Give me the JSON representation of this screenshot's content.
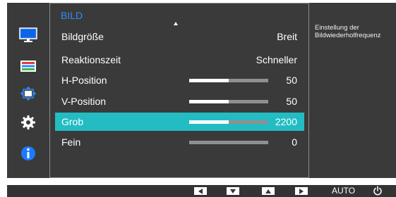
{
  "menu": {
    "title": "BILD",
    "items": [
      {
        "label": "Bildgröße",
        "value": "Breit"
      },
      {
        "label": "Reaktionszeit",
        "value": "Schneller"
      },
      {
        "label": "H-Position",
        "value": "50",
        "level": 0.5
      },
      {
        "label": "V-Position",
        "value": "50",
        "level": 0.5
      },
      {
        "label": "Grob",
        "value": "2200",
        "level": 0.5,
        "selected": true
      },
      {
        "label": "Fein",
        "value": "0",
        "level": 0
      }
    ]
  },
  "sidebar": {
    "items": [
      {
        "icon": "monitor-picture-icon",
        "selected": true
      },
      {
        "icon": "color-icon"
      },
      {
        "icon": "size-position-icon"
      },
      {
        "icon": "setup-gear-icon"
      },
      {
        "icon": "information-icon"
      }
    ]
  },
  "help": {
    "text": "Einstellung der\nBildwiederholfrequenz"
  },
  "bottom_bar": {
    "auto_label": "AUTO",
    "buttons": [
      "left-arrow-icon",
      "down-arrow-icon",
      "up-arrow-icon",
      "right-arrow-icon",
      "power-icon"
    ]
  },
  "colors": {
    "accent_blue": "#2f8bff",
    "highlight": "#23bcc3",
    "panel": "#3a3a3a",
    "border": "#8c8c8c"
  }
}
